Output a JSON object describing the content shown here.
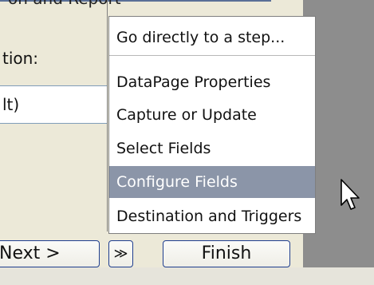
{
  "background": {
    "top_label": "on and Report",
    "field_caption": "tion:",
    "field_value": "lt)"
  },
  "menu": {
    "items": [
      "Go directly to a step...",
      "DataPage Properties",
      "Capture or Update",
      "Select Fields",
      "Configure Fields",
      "Destination and Triggers"
    ],
    "selected_index": 4
  },
  "buttons": {
    "next": "Next >",
    "more": "≫",
    "finish": "Finish"
  },
  "icons": {
    "cursor": "mouse-pointer-icon"
  },
  "colors": {
    "menu_highlight": "#8b95a8",
    "button_border": "#1f3e8f",
    "frame_line": "#5a6f97",
    "background": "#ece9d8",
    "dark_panel": "#8d8d8d"
  }
}
